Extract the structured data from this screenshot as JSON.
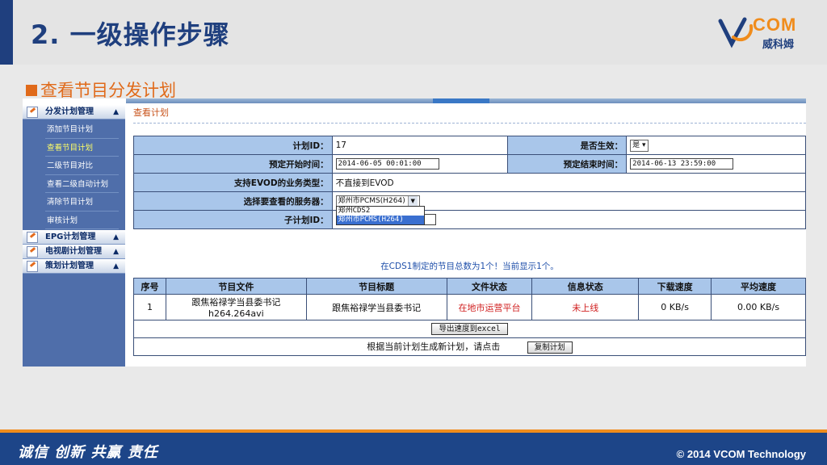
{
  "slide": {
    "title": "2. 一级操作步骤",
    "section": "查看节目分发计划",
    "logo_brand": "COM",
    "logo_sub": "威科姆",
    "slogan": "诚信 创新 共赢  责任",
    "copyright": "© 2014 VCOM Technology",
    "accent_color": "#f08c1c",
    "primary_color": "#1f3f7e"
  },
  "sidebar": {
    "groups": [
      {
        "label": "分发计划管理",
        "toggle": "▲",
        "items": [
          {
            "label": "添加节目计划",
            "active": false
          },
          {
            "label": "查看节目计划",
            "active": true
          },
          {
            "label": "二级节目对比",
            "active": false
          },
          {
            "label": "查看二级自动计划",
            "active": false
          },
          {
            "label": "清除节目计划",
            "active": false
          },
          {
            "label": "审核计划",
            "active": false
          }
        ]
      },
      {
        "label": "EPG计划管理",
        "toggle": "▲"
      },
      {
        "label": "电视剧计划管理",
        "toggle": "▲"
      },
      {
        "label": "策划计划管理",
        "toggle": "▲"
      }
    ]
  },
  "main": {
    "page_label": "查看计划",
    "form": {
      "plan_id_label": "计划ID：",
      "plan_id_value": "17",
      "effective_label": "是否生效：",
      "effective_value": "是",
      "start_label": "预定开始时间：",
      "start_value": "2014-06-05 00:01:00",
      "end_label": "预定结束时间：",
      "end_value": "2014-06-13 23:59:00",
      "evod_label": "支持EVOD的业务类型：",
      "evod_value": "不直接到EVOD",
      "server_label": "选择要查看的服务器：",
      "server_value": "郑州市PCMS(H264)",
      "server_options": [
        "郑州CDS2",
        "郑州市PCMS(H264)"
      ],
      "subplan_label": "子计划ID："
    },
    "summary": "在CDS1制定的节目总数为1个！当前显示1个。",
    "table": {
      "headers": [
        "序号",
        "节目文件",
        "节目标题",
        "文件状态",
        "信息状态",
        "下载速度",
        "平均速度"
      ],
      "rows": [
        {
          "index": "1",
          "file_line1": "跟焦裕禄学当县委书记",
          "file_line2": "h264.264avi",
          "title": "跟焦裕禄学当县委书记",
          "file_status": "在地市运营平台",
          "info_status": "未上线",
          "download_speed": "0 KB/s",
          "avg_speed": "0.00 KB/s"
        }
      ],
      "export_button": "导出速度到excel",
      "generate_text": "根据当前计划生成新计划，请点击",
      "copy_button": "复制计划"
    }
  }
}
